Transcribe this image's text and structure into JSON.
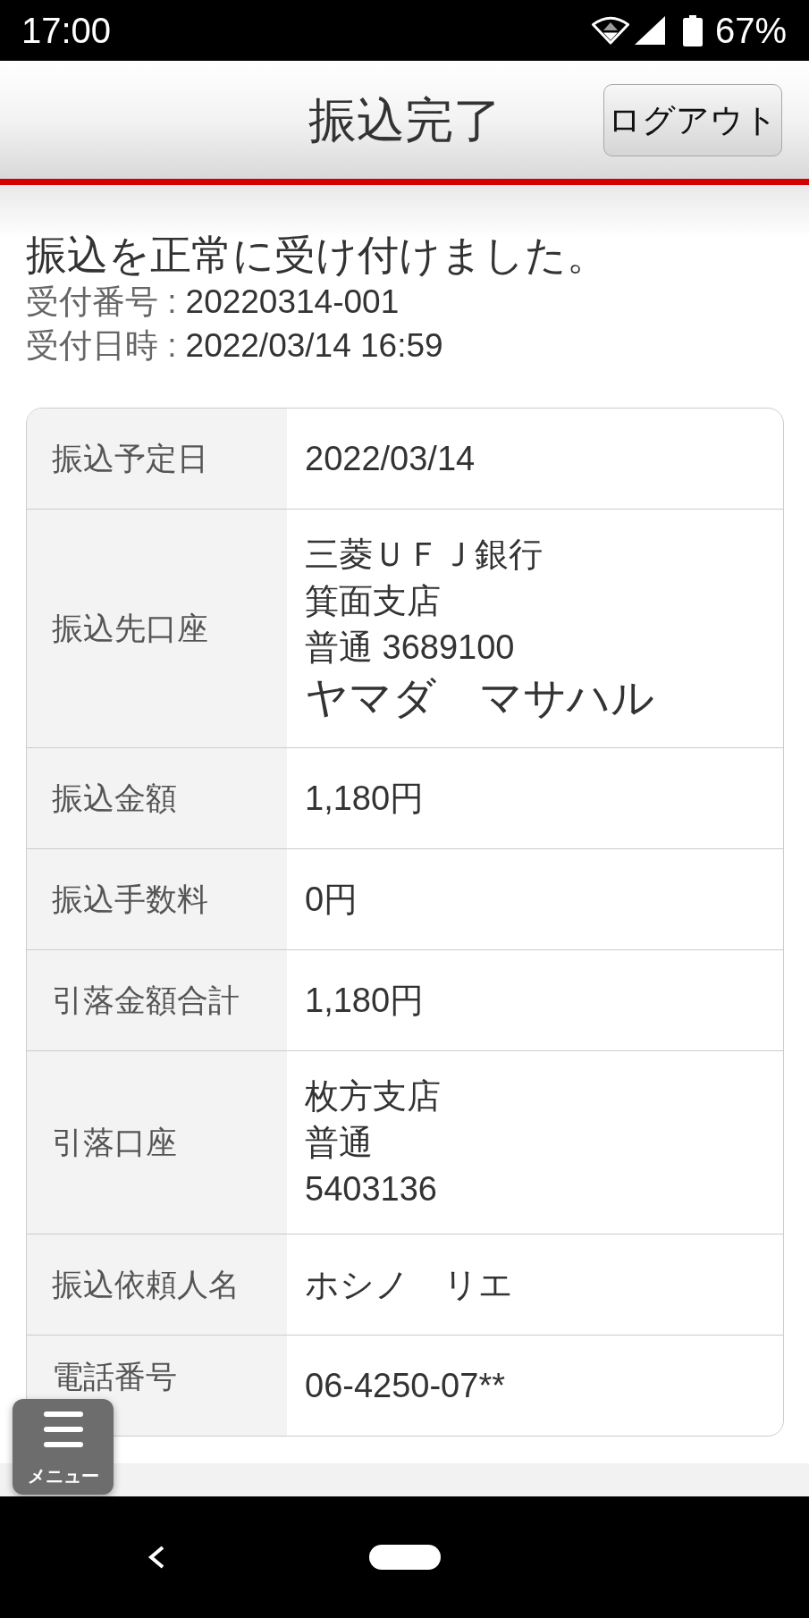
{
  "status_bar": {
    "time": "17:00",
    "battery": "67%"
  },
  "header": {
    "title": "振込完了",
    "logout_button": "ログアウト"
  },
  "result": {
    "message": "振込を正常に受け付けました。",
    "receipt": [
      {
        "label": "受付番号 :",
        "value": "20220314-001"
      },
      {
        "label": "受付日時 :",
        "value": "2022/03/14 16:59"
      }
    ]
  },
  "details": {
    "rows": [
      {
        "label": "振込予定日",
        "lines": [
          "2022/03/14"
        ]
      },
      {
        "label": "振込先口座",
        "lines": [
          "三菱ＵＦＪ銀行",
          "箕面支店",
          "普通 3689100"
        ],
        "payee_name": "ヤマダ　マサハル"
      },
      {
        "label": "振込金額",
        "lines": [
          "1,180円"
        ]
      },
      {
        "label": "振込手数料",
        "lines": [
          "0円"
        ]
      },
      {
        "label": "引落金額合計",
        "lines": [
          "1,180円"
        ]
      },
      {
        "label": "引落口座",
        "lines": [
          "枚方支店",
          "普通",
          "5403136"
        ]
      },
      {
        "label": "振込依頼人名",
        "lines": [
          "ホシノ　リエ"
        ]
      },
      {
        "label": "電話番号",
        "lines": [
          "06-4250-07**"
        ]
      }
    ]
  },
  "menu_button": {
    "label": "メニュー"
  }
}
